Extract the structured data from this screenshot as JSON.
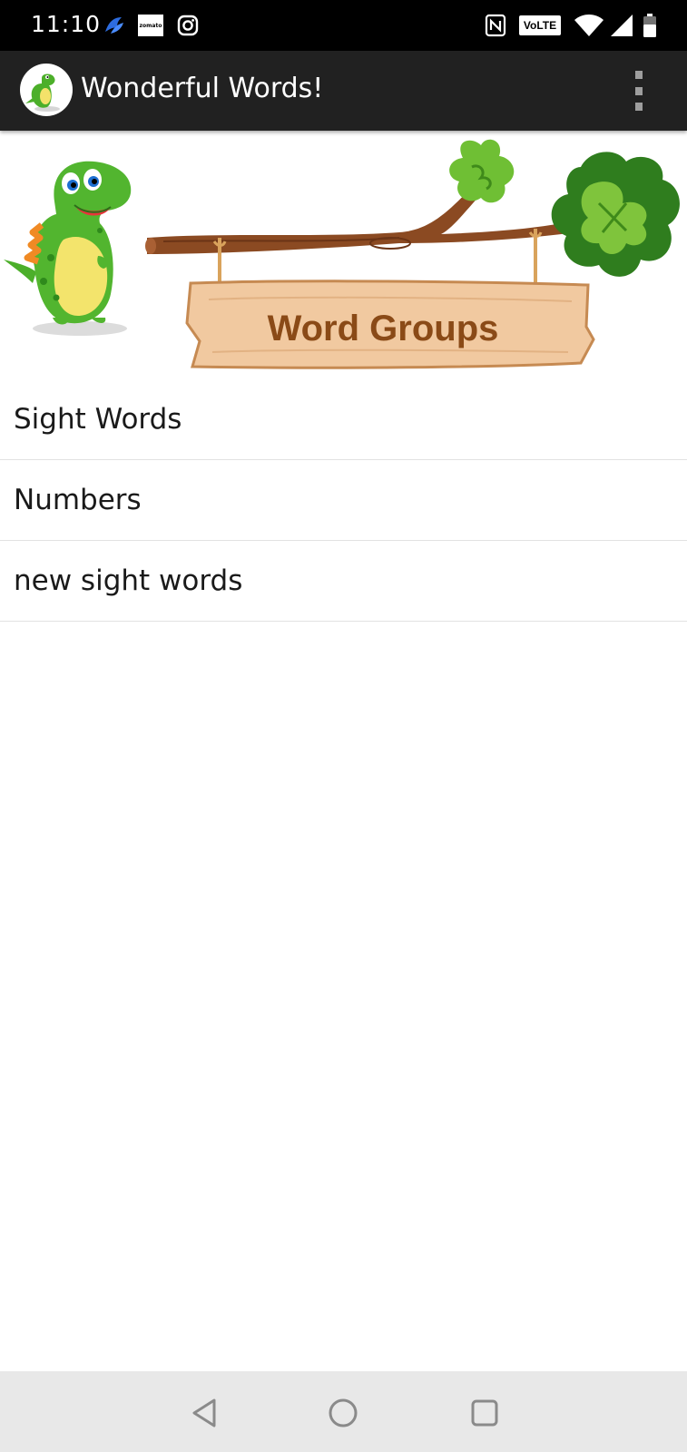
{
  "status_bar": {
    "time": "11:10",
    "left_icons": [
      "app-notification-icon",
      "zomato-icon",
      "instagram-icon"
    ],
    "zomato_text": "zomato",
    "right_icons": [
      "nfc-icon",
      "volte-icon",
      "wifi-icon",
      "signal-icon",
      "battery-icon"
    ],
    "volte_text": "VoLTE"
  },
  "app_bar": {
    "title": "Wonderful Words!",
    "menu_icon": "more-vert-icon"
  },
  "banner": {
    "title": "Word Groups",
    "title_color": "#8a4a17"
  },
  "list": {
    "items": [
      {
        "label": "Sight Words"
      },
      {
        "label": "Numbers"
      },
      {
        "label": "new sight words"
      }
    ]
  },
  "nav_bar": {
    "icons": [
      "back-icon",
      "home-icon",
      "recents-icon"
    ]
  }
}
